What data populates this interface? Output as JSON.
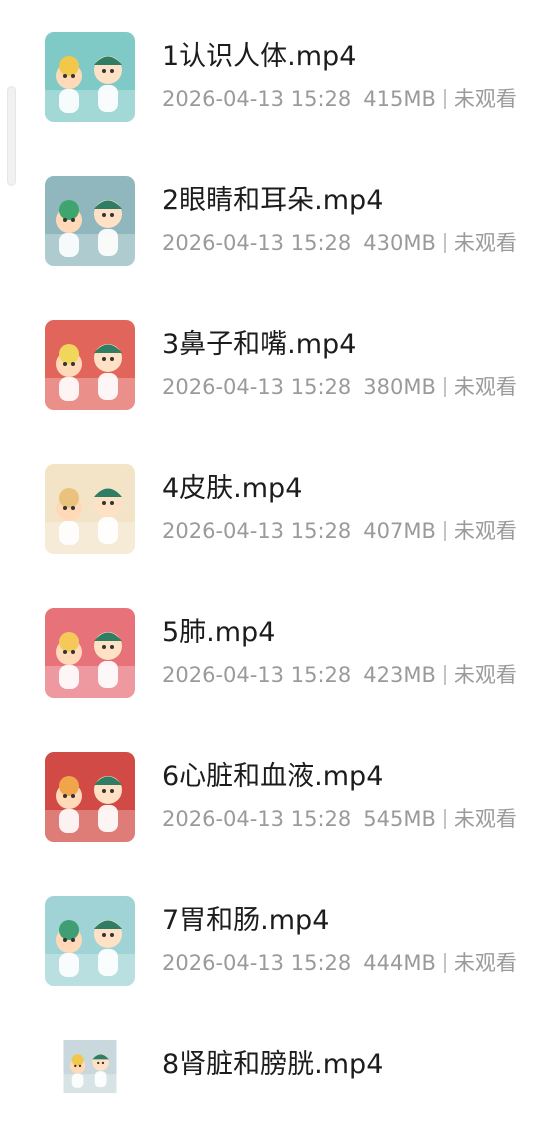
{
  "files": [
    {
      "name": "1认识人体.mp4",
      "date": "2026-04-13 15:28",
      "size": "415MB",
      "status": "未观看",
      "thumb_bg": "#7fc9c7",
      "thumb_accent": "#f2c84b"
    },
    {
      "name": "2眼睛和耳朵.mp4",
      "date": "2026-04-13 15:28",
      "size": "430MB",
      "status": "未观看",
      "thumb_bg": "#8fb7bd",
      "thumb_accent": "#3fa56e"
    },
    {
      "name": "3鼻子和嘴.mp4",
      "date": "2026-04-13 15:28",
      "size": "380MB",
      "status": "未观看",
      "thumb_bg": "#e2655c",
      "thumb_accent": "#f0d65a"
    },
    {
      "name": "4皮肤.mp4",
      "date": "2026-04-13 15:28",
      "size": "407MB",
      "status": "未观看",
      "thumb_bg": "#f3e4c8",
      "thumb_accent": "#e9c37d"
    },
    {
      "name": "5肺.mp4",
      "date": "2026-04-13 15:28",
      "size": "423MB",
      "status": "未观看",
      "thumb_bg": "#e8727a",
      "thumb_accent": "#f4c95a"
    },
    {
      "name": "6心脏和血液.mp4",
      "date": "2026-04-13 15:28",
      "size": "545MB",
      "status": "未观看",
      "thumb_bg": "#d14a45",
      "thumb_accent": "#f0a54a"
    },
    {
      "name": "7胃和肠.mp4",
      "date": "2026-04-13 15:28",
      "size": "444MB",
      "status": "未观看",
      "thumb_bg": "#9fd3d6",
      "thumb_accent": "#3f9e73"
    },
    {
      "name": "8肾脏和膀胱.mp4",
      "date": "",
      "size": "",
      "status": "",
      "thumb_bg": "#c9d8dc",
      "thumb_accent": "#f2c84b"
    }
  ]
}
